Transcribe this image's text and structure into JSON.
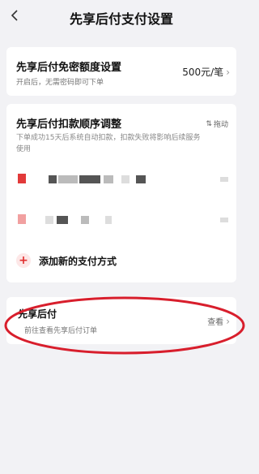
{
  "header": {
    "title": "先享后付支付设置",
    "back_icon": "chevron-left-icon"
  },
  "limit_card": {
    "title": "先享后付免密额度设置",
    "subtitle": "开启后，无需密码即可下单",
    "value": "500元/笔"
  },
  "order_card": {
    "title": "先享后付扣款顺序调整",
    "description": "下单成功15天后系统自动扣款，扣款失败将影响后续服务使用",
    "drag_label": "拖动",
    "payment_methods": [
      {},
      {}
    ],
    "add_label": "添加新的支付方式"
  },
  "order_link_card": {
    "title": "先享后付",
    "subtitle": "前往查看先享后付订单",
    "action": "查看"
  },
  "colors": {
    "accent": "#e02e2e",
    "annotation": "#d81e2c"
  }
}
